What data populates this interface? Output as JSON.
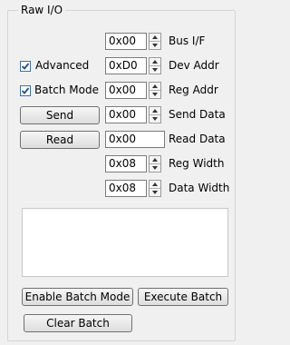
{
  "group": {
    "title": "Raw I/O"
  },
  "rows": {
    "bus_if": {
      "value": "0x00",
      "label": "Bus I/F"
    },
    "dev_addr": {
      "value": "0xD0",
      "label": "Dev Addr"
    },
    "reg_addr": {
      "value": "0x00",
      "label": "Reg Addr"
    },
    "send_data": {
      "value": "0x00",
      "label": "Send Data"
    },
    "read_data": {
      "value": "0x00",
      "label": "Read Data"
    },
    "reg_width": {
      "value": "0x08",
      "label": "Reg Width"
    },
    "data_width": {
      "value": "0x08",
      "label": "Data Width"
    }
  },
  "options": {
    "advanced": {
      "label": "Advanced",
      "checked": true
    },
    "batch_mode": {
      "label": "Batch Mode",
      "checked": true
    }
  },
  "buttons": {
    "send": "Send",
    "read": "Read",
    "enable_batch": "Enable Batch Mode",
    "execute_batch": "Execute Batch",
    "clear_batch": "Clear Batch"
  },
  "colors": {
    "accent": "#3b6fb3",
    "background": "#f0f0f0"
  }
}
